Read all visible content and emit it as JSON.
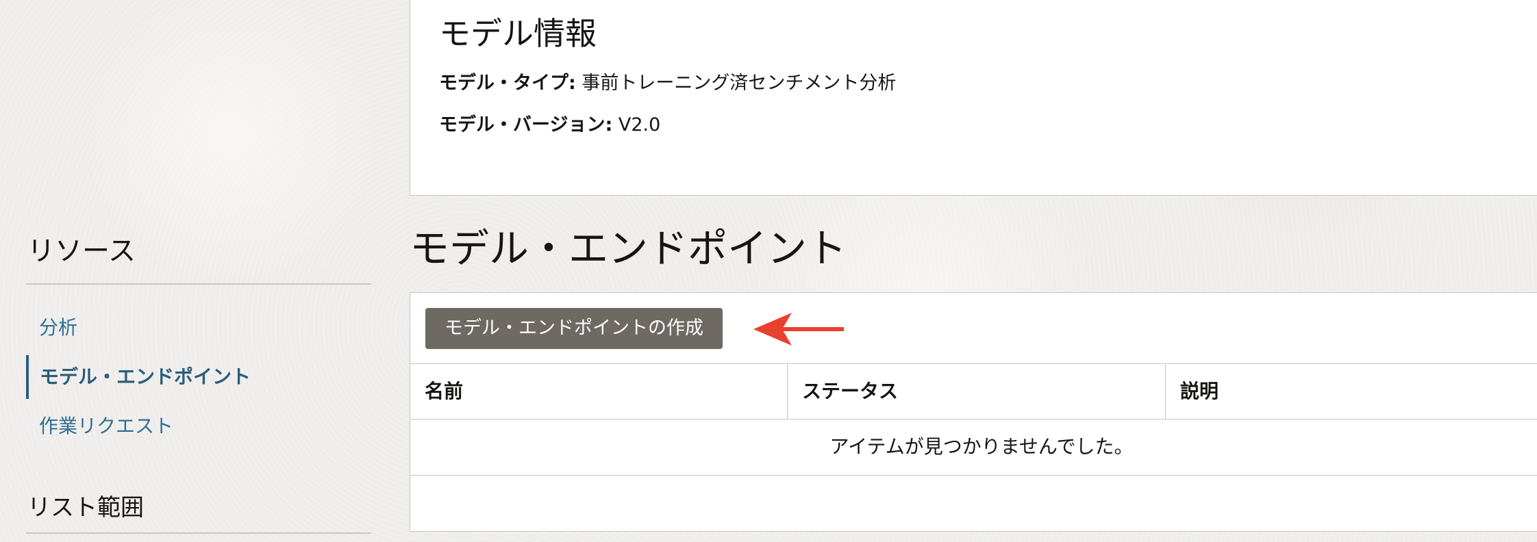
{
  "model_info": {
    "title": "モデル情報",
    "type_label": "モデル・タイプ:",
    "type_value": "事前トレーニング済センチメント分析",
    "version_label": "モデル・バージョン:",
    "version_value": "V2.0"
  },
  "sidebar": {
    "resources_heading": "リソース",
    "items": [
      {
        "label": "分析",
        "active": false
      },
      {
        "label": "モデル・エンドポイント",
        "active": true
      },
      {
        "label": "作業リクエスト",
        "active": false
      }
    ],
    "list_scope_heading": "リスト範囲"
  },
  "endpoints": {
    "title": "モデル・エンドポイント",
    "create_button": "モデル・エンドポイントの作成",
    "columns": [
      "名前",
      "ステータス",
      "説明"
    ],
    "empty_message": "アイテムが見つかりませんでした。"
  },
  "colors": {
    "link": "#2f6f93",
    "active_nav": "#2c5d7c",
    "button_bg": "#6f6964",
    "annotation_arrow": "#e8412f"
  },
  "icons": {
    "annotation": "red-arrow-left-icon"
  }
}
